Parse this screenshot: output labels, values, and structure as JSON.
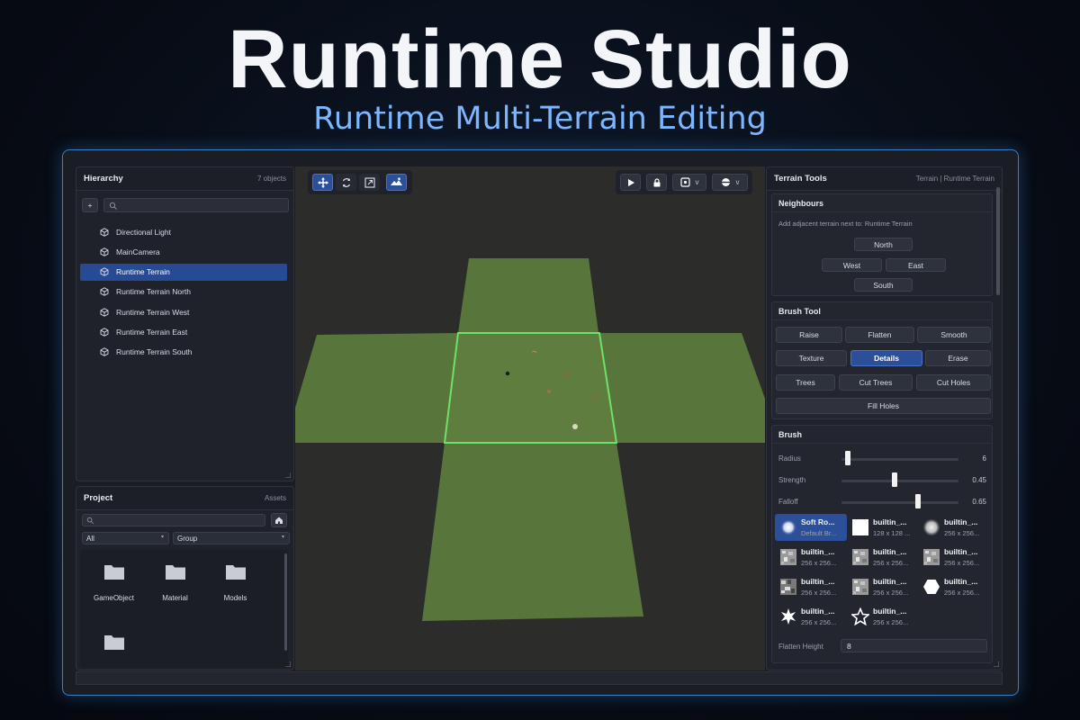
{
  "hero": {
    "title": "Runtime Studio",
    "subtitle": "Runtime Multi-Terrain Editing"
  },
  "hierarchy": {
    "title": "Hierarchy",
    "count": "7 objects",
    "add_label": "+",
    "search_placeholder": "",
    "items": [
      {
        "label": "Directional Light"
      },
      {
        "label": "MainCamera"
      },
      {
        "label": "Runtime Terrain",
        "selected": true
      },
      {
        "label": "Runtime Terrain North"
      },
      {
        "label": "Runtime Terrain West"
      },
      {
        "label": "Runtime Terrain East"
      },
      {
        "label": "Runtime Terrain South"
      }
    ]
  },
  "project": {
    "title": "Project",
    "assets_label": "Assets",
    "filter_type": "All",
    "filter_group": "Group",
    "folders": [
      {
        "label": "GameObject"
      },
      {
        "label": "Material"
      },
      {
        "label": "Models"
      },
      {
        "label": ""
      }
    ]
  },
  "viewport": {
    "tools": [
      "move-icon",
      "rotate-icon",
      "scale-icon",
      "terrain-icon"
    ],
    "play_icon": "play-icon",
    "lock_icon": "lock-icon",
    "gizmo_label": "v",
    "shading_label": "v"
  },
  "terrain_tools": {
    "title": "Terrain Tools",
    "breadcrumb": "Terrain | Runtime Terrain",
    "neighbours": {
      "title": "Neighbours",
      "hint": "Add adjacent terrain next to: Runtime Terrain",
      "north": "North",
      "west": "West",
      "east": "East",
      "south": "South"
    },
    "brush_tool": {
      "title": "Brush Tool",
      "raise": "Raise",
      "flatten": "Flatten",
      "smooth": "Smooth",
      "texture": "Texture",
      "details": "Details",
      "erase": "Erase",
      "trees": "Trees",
      "cut_trees": "Cut Trees",
      "cut_holes": "Cut Holes",
      "fill_holes": "Fill Holes"
    },
    "brush": {
      "title": "Brush",
      "radius_label": "Radius",
      "radius_value": "6",
      "radius_fraction": 0.05,
      "strength_label": "Strength",
      "strength_value": "0.45",
      "strength_fraction": 0.45,
      "falloff_label": "Falloff",
      "falloff_value": "0.65",
      "falloff_fraction": 0.65,
      "flatten_label": "Flatten Height",
      "flatten_value": "8",
      "brushes": [
        {
          "name": "Soft Ro...",
          "size": "Default Br...",
          "icon": "soft-round",
          "selected": true
        },
        {
          "name": "builtin_...",
          "size": "128 x 128 ...",
          "icon": "square"
        },
        {
          "name": "builtin_...",
          "size": "256 x 256...",
          "icon": "fuzzy"
        },
        {
          "name": "builtin_...",
          "size": "256 x 256...",
          "icon": "noise"
        },
        {
          "name": "builtin_...",
          "size": "256 x 256...",
          "icon": "noise"
        },
        {
          "name": "builtin_...",
          "size": "256 x 256...",
          "icon": "noise"
        },
        {
          "name": "builtin_...",
          "size": "256 x 256...",
          "icon": "noise-dark"
        },
        {
          "name": "builtin_...",
          "size": "256 x 256...",
          "icon": "noise"
        },
        {
          "name": "builtin_...",
          "size": "256 x 256...",
          "icon": "hexagon"
        },
        {
          "name": "builtin_...",
          "size": "256 x 256...",
          "icon": "star-burst"
        },
        {
          "name": "builtin_...",
          "size": "256 x 256...",
          "icon": "star-outline"
        }
      ]
    }
  }
}
